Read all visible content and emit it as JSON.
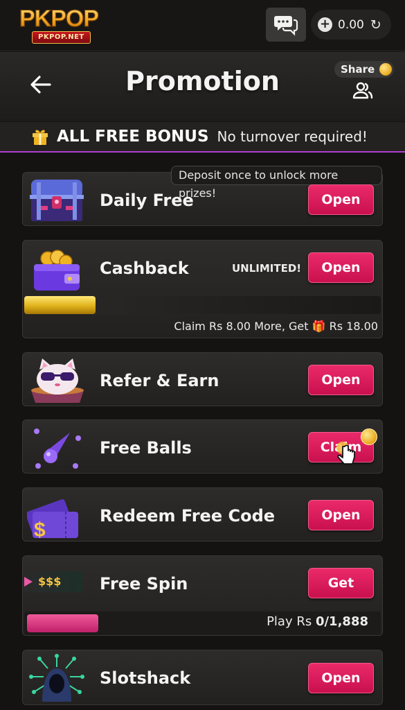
{
  "header": {
    "logo_text": "PKPOP",
    "logo_sub": "PKPOP.NET",
    "balance": "0.00"
  },
  "page": {
    "title": "Promotion",
    "share_label": "Share"
  },
  "bonus_banner": {
    "title": "ALL FREE BONUS",
    "subtitle": "No turnover required!"
  },
  "promos": {
    "daily_free": {
      "label": "Daily Free",
      "tip": "Deposit once to unlock more prizes!",
      "button": "Open"
    },
    "cashback": {
      "label": "Cashback",
      "badge": "UNLIMITED!",
      "button": "Open",
      "progress": 0.2,
      "note_prefix": "Claim Rs 8.00 More, Get",
      "note_reward": "Rs 18.00"
    },
    "refer_earn": {
      "label": "Refer & Earn",
      "button": "Open"
    },
    "free_balls": {
      "label": "Free Balls",
      "button": "Claim"
    },
    "redeem_code": {
      "label": "Redeem Free Code",
      "button": "Open"
    },
    "free_spin": {
      "label": "Free Spin",
      "button": "Get",
      "ticket_text": "$$$",
      "progress": 0.2,
      "play_prefix": "Play Rs",
      "play_value": "0/1,888"
    },
    "slotshack": {
      "label": "Slotshack",
      "button": "Open"
    }
  },
  "colors": {
    "accent": "#e0175a",
    "banner_underline": "#b13fd0",
    "gold": "#f0b323"
  }
}
